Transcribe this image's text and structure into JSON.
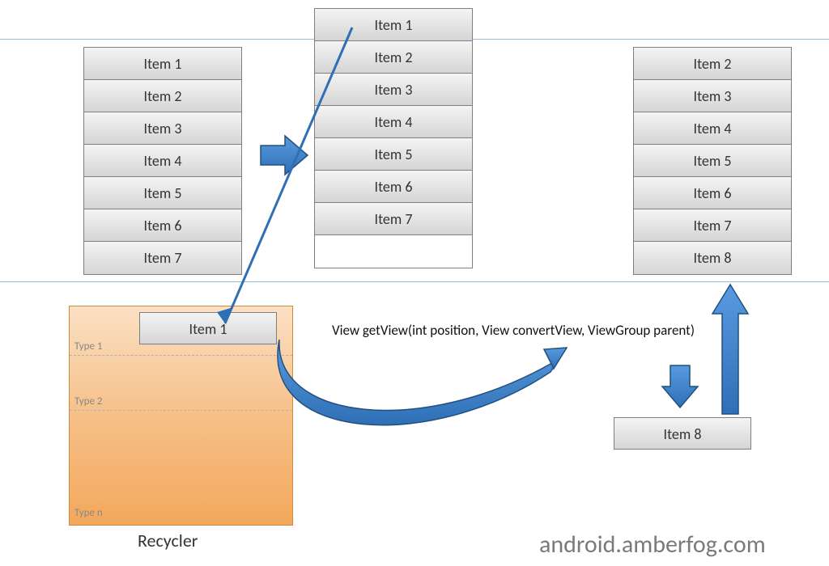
{
  "lists": {
    "left": [
      "Item 1",
      "Item 2",
      "Item 3",
      "Item 4",
      "Item 5",
      "Item 6",
      "Item 7"
    ],
    "middle": [
      "Item 1",
      "Item 2",
      "Item 3",
      "Item 4",
      "Item 5",
      "Item 6",
      "Item 7"
    ],
    "right": [
      "Item 2",
      "Item 3",
      "Item 4",
      "Item 5",
      "Item 6",
      "Item 7",
      "Item 8"
    ]
  },
  "recycler": {
    "title": "Recycler",
    "recycled_item": "Item 1",
    "types": {
      "t1": "Type 1",
      "t2": "Type 2",
      "tn": "Type n"
    }
  },
  "new_item": "Item 8",
  "code": "View getView(int position, View convertView, ViewGroup parent)",
  "footer": "android.amberfog.com",
  "colors": {
    "arrow": "#2f6fb5",
    "arrow_stroke": "#21507f"
  }
}
